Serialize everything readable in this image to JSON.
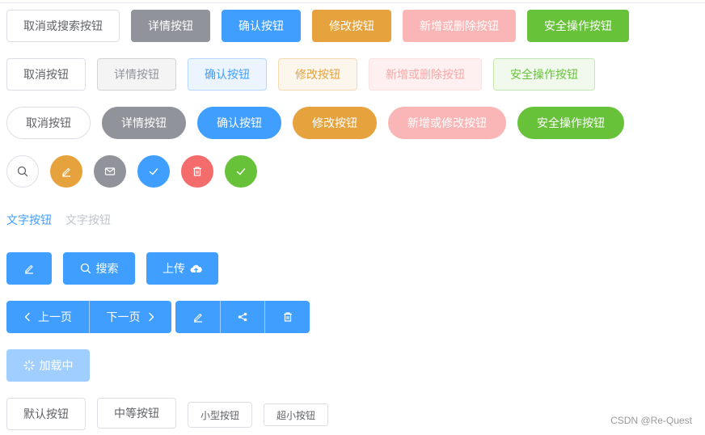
{
  "row1": {
    "cancel_search": "取消或搜索按钮",
    "detail": "详情按钮",
    "confirm": "确认按钮",
    "edit": "修改按钮",
    "add_delete": "新增或删除按钮",
    "safe": "安全操作按钮"
  },
  "row2": {
    "cancel": "取消按钮",
    "detail": "详情按钮",
    "confirm": "确认按钮",
    "edit": "修改按钮",
    "add_delete": "新增或删除按钮",
    "safe": "安全操作按钮"
  },
  "row3": {
    "cancel": "取消按钮",
    "detail": "详情按钮",
    "confirm": "确认按钮",
    "edit": "修改按钮",
    "add_edit": "新增或修改按钮",
    "safe": "安全操作按钮"
  },
  "circle_icons": [
    "search-icon",
    "edit-icon",
    "message-icon",
    "check-icon",
    "delete-icon",
    "check-icon"
  ],
  "text_buttons": {
    "enabled": "文字按钮",
    "disabled": "文字按钮"
  },
  "icon_buttons": {
    "search": "搜索",
    "upload": "上传"
  },
  "group": {
    "prev": "上一页",
    "next": "下一页"
  },
  "loading": {
    "label": "加载中"
  },
  "sizes": {
    "default": "默认按钮",
    "medium": "中等按钮",
    "small": "小型按钮",
    "mini": "超小按钮"
  },
  "watermark": "CSDN @Re-Quest",
  "colors": {
    "primary": "#409eff",
    "success": "#67c23a",
    "warning": "#e6a23c",
    "danger": "#f56c6c",
    "info": "#909399"
  }
}
